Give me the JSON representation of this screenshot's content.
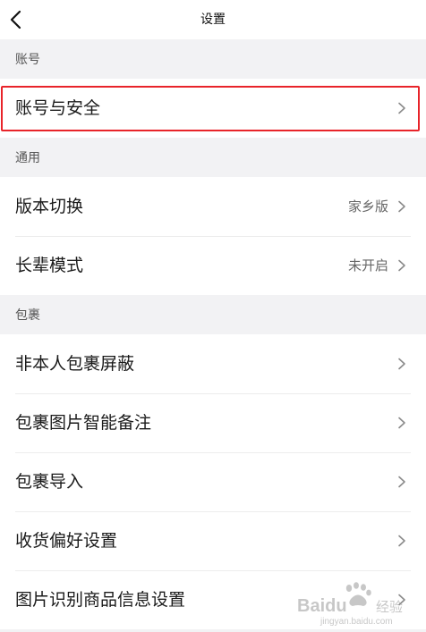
{
  "header": {
    "title": "设置",
    "back_icon": "chevron-left-icon"
  },
  "sections": {
    "account": {
      "title": "账号",
      "items": [
        {
          "label": "账号与安全",
          "value": ""
        }
      ]
    },
    "general": {
      "title": "通用",
      "items": [
        {
          "label": "版本切换",
          "value": "家乡版"
        },
        {
          "label": "长辈模式",
          "value": "未开启"
        }
      ]
    },
    "package": {
      "title": "包裹",
      "items": [
        {
          "label": "非本人包裹屏蔽",
          "value": ""
        },
        {
          "label": "包裹图片智能备注",
          "value": ""
        },
        {
          "label": "包裹导入",
          "value": ""
        },
        {
          "label": "收货偏好设置",
          "value": ""
        },
        {
          "label": "图片识别商品信息设置",
          "value": ""
        }
      ]
    }
  },
  "colors": {
    "highlight": "#e8242a",
    "background": "#f2f2f4",
    "card": "#ffffff"
  },
  "watermark": {
    "brand": "Baidu",
    "sub": "经验",
    "url": "jingyan.baidu.com"
  }
}
